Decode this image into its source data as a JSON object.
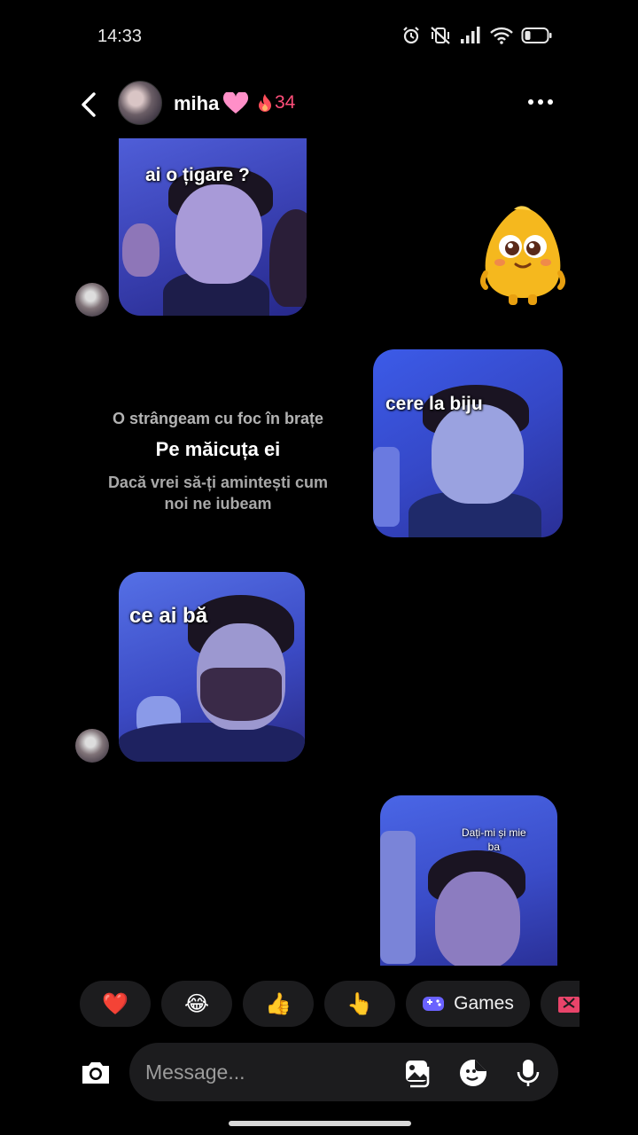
{
  "status_bar": {
    "time": "14:33"
  },
  "header": {
    "contact_name": "miha",
    "streak_count": "34"
  },
  "messages": [
    {
      "type": "image",
      "from": "them",
      "caption": "ai o țigare ?"
    },
    {
      "type": "sticker",
      "from": "me"
    },
    {
      "type": "image",
      "from": "me",
      "caption": "cere la biju"
    },
    {
      "type": "image",
      "from": "them",
      "caption": "ce ai bă"
    },
    {
      "type": "image",
      "from": "me",
      "caption_line1": "Dați-mi și mie",
      "caption_line2": "ba"
    }
  ],
  "lyrics": {
    "line1": "O strângeam cu foc în brațe",
    "line2": "Pe măicuța ei",
    "line3a": "Dacă vrei să-ți amintești cum",
    "line3b": "noi ne iubeam"
  },
  "quick_reactions": {
    "items": [
      "❤️",
      "😂",
      "👍",
      "👆"
    ],
    "games_label": "Games"
  },
  "composer": {
    "placeholder": "Message..."
  },
  "colors": {
    "background": "#000000",
    "streak": "#ff4e7a",
    "pill": "#1c1c1e"
  }
}
